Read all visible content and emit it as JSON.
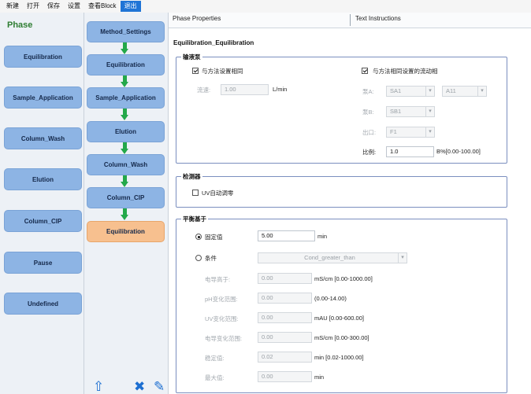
{
  "menu": [
    {
      "label": "新建"
    },
    {
      "label": "打开"
    },
    {
      "label": "保存"
    },
    {
      "label": "设置"
    },
    {
      "label": "查看Block"
    },
    {
      "label": "退出"
    }
  ],
  "phase_panel": {
    "title": "Phase",
    "items": [
      "Equilibration",
      "Sample_Application",
      "Column_Wash",
      "Elution",
      "Column_CIP",
      "Pause",
      "Undefined"
    ]
  },
  "flow": {
    "nodes": [
      "Method_Settings",
      "Equilibration",
      "Sample_Application",
      "Elution",
      "Column_Wash",
      "Column_CIP",
      "Equilibration"
    ],
    "selected_index": 6,
    "tools": {
      "up": "⇧",
      "delete": "✖",
      "edit": "✎"
    }
  },
  "props": {
    "tabs": [
      "Phase Properties",
      "Text Instructions"
    ],
    "phase_name": "Equilibration_Equilibration",
    "pump": {
      "title": "输液泵",
      "same_flow_label": "与方法设置相同",
      "same_flow_checked": true,
      "same_phase_label": "与方法相同设置的流动相",
      "same_phase_checked": true,
      "flow_label": "流速:",
      "flow_value": "1.00",
      "flow_unit": "L/min",
      "pump_a_label": "泵A:",
      "pump_a_value": "SA1",
      "pump_a2_value": "A11",
      "pump_b_label": "泵B:",
      "pump_b_value": "SB1",
      "outlet_label": "出口:",
      "outlet_value": "F1",
      "ratio_label": "比例:",
      "ratio_value": "1.0",
      "ratio_unit": "B%[0.00-100.00]"
    },
    "detector": {
      "title": "检测器",
      "uv_zero_label": "UV自动调零",
      "uv_zero_checked": false
    },
    "balance": {
      "title": "平衡基于",
      "fixed_label": "固定值",
      "fixed_selected": true,
      "fixed_value": "5.00",
      "fixed_unit": "min",
      "cond_label": "条件",
      "cond_value": "Cond_greater_than",
      "rows": [
        {
          "label": "电导高于:",
          "value": "0.00",
          "unit": "mS/cm [0.00-1000.00]"
        },
        {
          "label": "pH变化范围:",
          "value": "0.00",
          "unit": "(0.00-14.00)"
        },
        {
          "label": "UV变化范围:",
          "value": "0.00",
          "unit": "mAU [0.00-600.00]"
        },
        {
          "label": "电导变化范围:",
          "value": "0.00",
          "unit": "mS/cm [0.00-300.00]"
        },
        {
          "label": "稳定值:",
          "value": "0.02",
          "unit": "min [0.02-1000.00]"
        },
        {
          "label": "最大值:",
          "value": "0.00",
          "unit": "min"
        }
      ]
    }
  }
}
